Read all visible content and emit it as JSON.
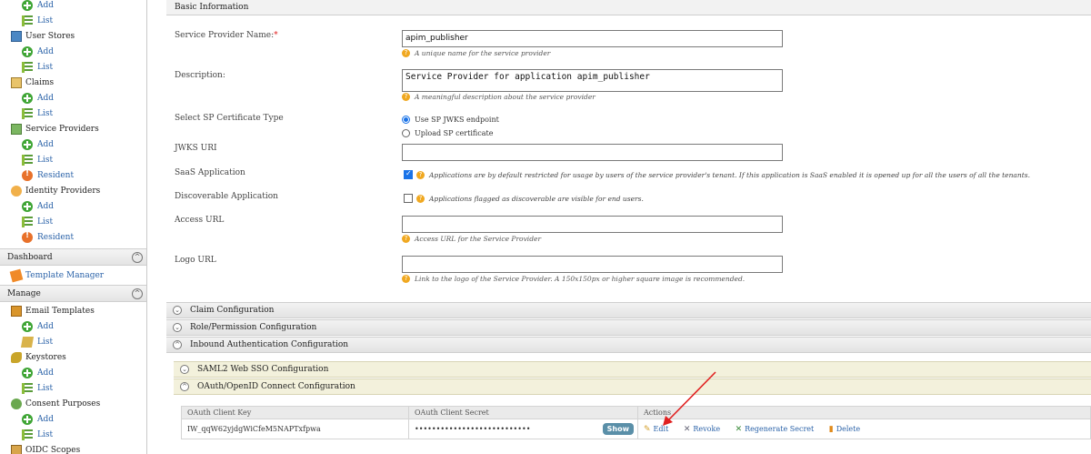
{
  "sidebar": {
    "rows": [
      {
        "label": "Add",
        "icon": "plus-icon"
      },
      {
        "label": "List",
        "icon": "list-icon"
      },
      {
        "label": "User Stores",
        "icon": "user-store-icon"
      },
      {
        "label": "Add",
        "icon": "plus-icon"
      },
      {
        "label": "List",
        "icon": "list-icon"
      },
      {
        "label": "Claims",
        "icon": "claims-icon"
      },
      {
        "label": "Add",
        "icon": "plus-icon"
      },
      {
        "label": "List",
        "icon": "list-icon"
      },
      {
        "label": "Service Providers",
        "icon": "service-provider-icon"
      },
      {
        "label": "Add",
        "icon": "plus-icon"
      },
      {
        "label": "List",
        "icon": "list-icon"
      },
      {
        "label": "Resident",
        "icon": "resident-icon"
      },
      {
        "label": "Identity Providers",
        "icon": "identity-provider-icon"
      },
      {
        "label": "Add",
        "icon": "plus-icon"
      },
      {
        "label": "List",
        "icon": "list-icon"
      },
      {
        "label": "Resident",
        "icon": "resident-icon"
      }
    ],
    "dashboard": {
      "label": "Dashboard",
      "toggle": "^"
    },
    "template_manager": "Template Manager",
    "manage": {
      "label": "Manage",
      "toggle": "^"
    },
    "manage_rows": [
      {
        "label": "Email Templates"
      },
      {
        "label": "Add"
      },
      {
        "label": "List"
      },
      {
        "label": "Keystores"
      },
      {
        "label": "Add"
      },
      {
        "label": "List"
      },
      {
        "label": "Consent Purposes"
      },
      {
        "label": "Add"
      },
      {
        "label": "List"
      },
      {
        "label": "OIDC Scopes"
      }
    ]
  },
  "main": {
    "panel_title": "Basic Information",
    "sp_name_label": "Service Provider Name:",
    "required_mark": "*",
    "sp_name_value": "apim_publisher",
    "sp_name_hint": "A unique name for the service provider",
    "description_label": "Description:",
    "description_value": "Service Provider for application apim_publisher",
    "description_hint": "A meaningful description about the service provider",
    "cert_label": "Select SP Certificate Type",
    "cert_option_jwks": "Use SP JWKS endpoint",
    "cert_option_upload": "Upload SP certificate",
    "jwks_label": "JWKS URI",
    "saas_label": "SaaS Application",
    "saas_text": "Applications are by default restricted for usage by users of the service provider's tenant. If this application is SaaS enabled it is opened up for all the users of all the tenants.",
    "saas_checked": true,
    "discoverable_label": "Discoverable Application",
    "discoverable_text": "Applications flagged as discoverable are visible for end users.",
    "discoverable_checked": false,
    "access_url_label": "Access URL",
    "access_url_hint": "Access URL for the Service Provider",
    "logo_url_label": "Logo URL",
    "logo_url_hint": "Link to the logo of the Service Provider. A 150x150px or higher square image is recommended."
  },
  "sections": {
    "claim": "Claim Configuration",
    "role": "Role/Permission Configuration",
    "inbound": "Inbound Authentication Configuration",
    "saml": "SAML2 Web SSO Configuration",
    "oauth": "OAuth/OpenID Connect Configuration"
  },
  "oauth_table": {
    "headers": [
      "OAuth Client Key",
      "OAuth Client Secret",
      "Actions"
    ],
    "client_key": "IW_qqW62yjdgWiCfeM5NAPTxfpwa",
    "client_secret_masked": "•••••••••••••••••••••••••••",
    "show_label": "Show",
    "actions": {
      "edit": "Edit",
      "revoke": "Revoke",
      "regenerate": "Regenerate Secret",
      "delete": "Delete"
    }
  },
  "colors": {
    "annotation_arrow": "#e02020",
    "link": "#2a62a8",
    "show_button": "#5a8fa8"
  }
}
